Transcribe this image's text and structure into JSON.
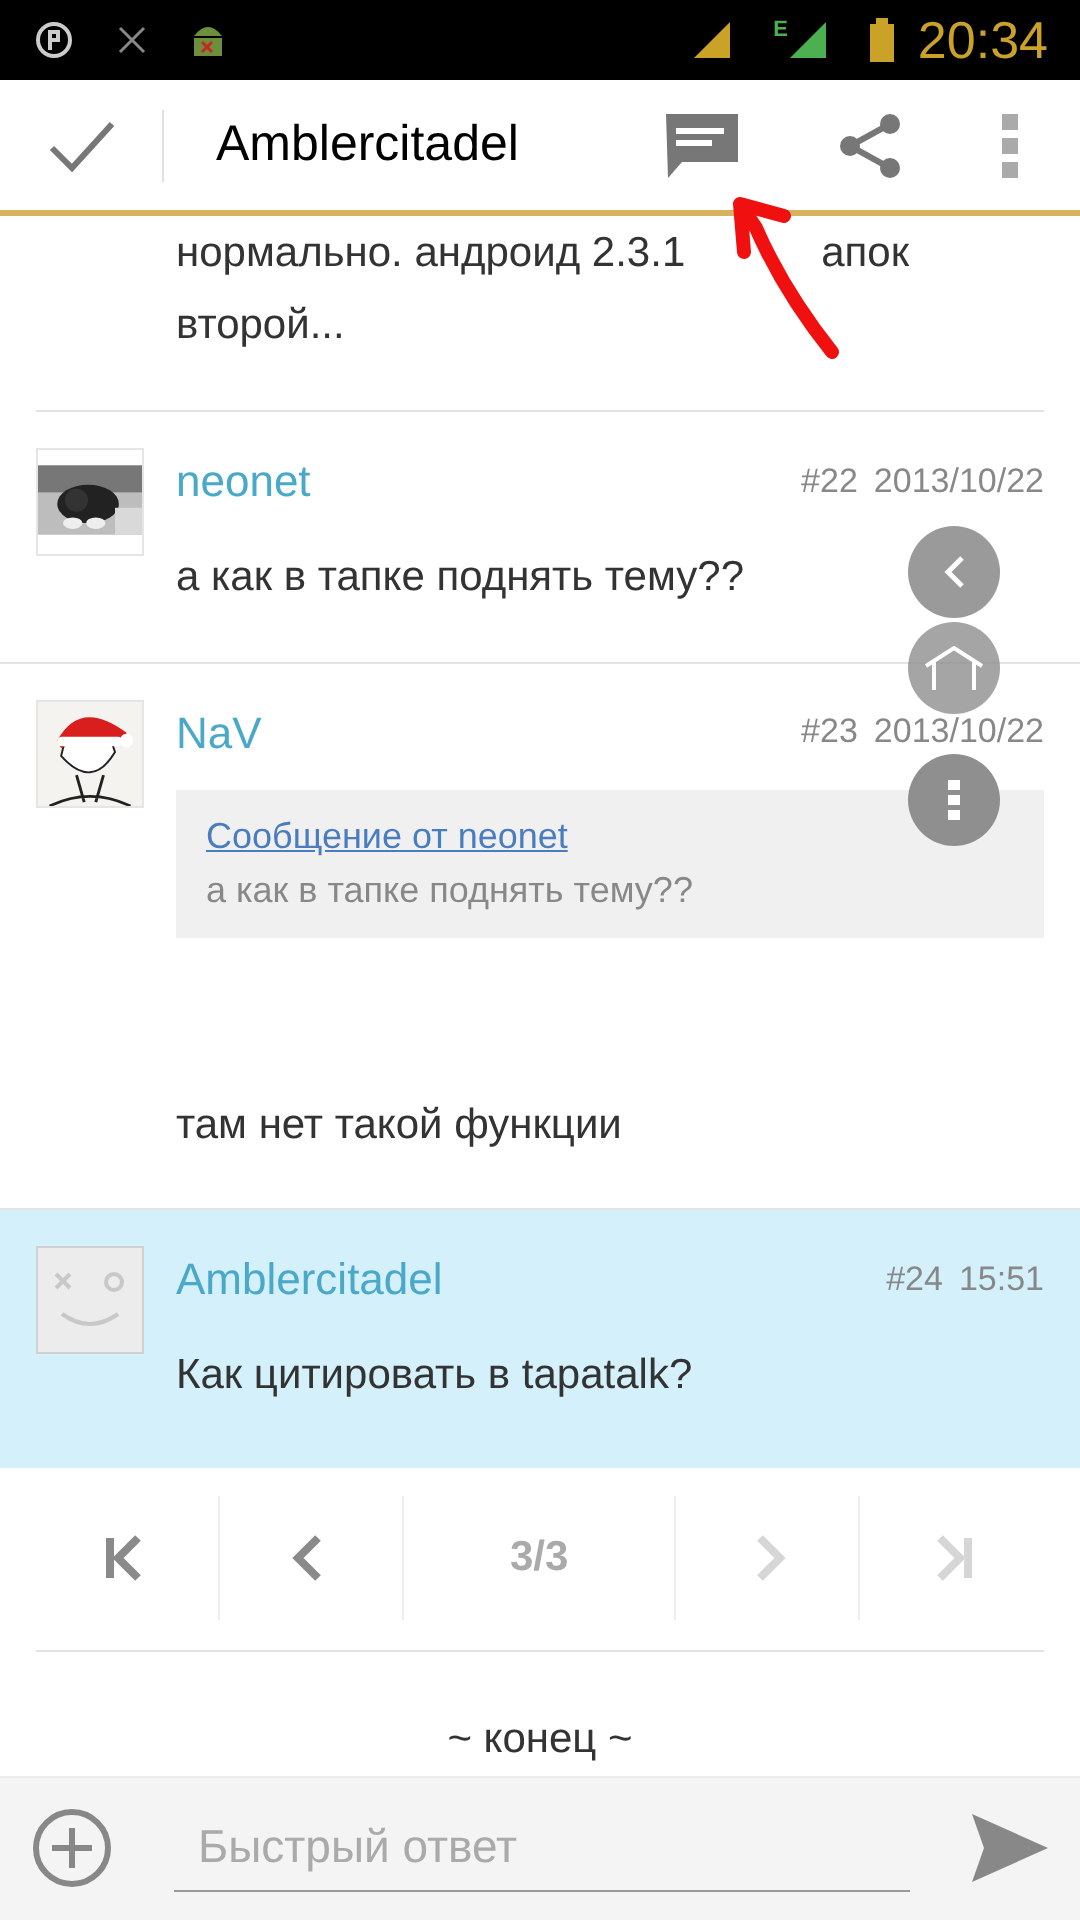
{
  "status_bar": {
    "network": "E",
    "time": "20:34"
  },
  "toolbar": {
    "title": "Amblercitadel"
  },
  "partial_post": {
    "line_start": "нормально. андроид 2.3.1",
    "line_end": "апок",
    "second_line": "второй..."
  },
  "posts": [
    {
      "author": "neonet",
      "number": "#22",
      "date": "2013/10/22",
      "body": "а как в тапке поднять тему??",
      "highlighted": false
    },
    {
      "author": "NaV",
      "number": "#23",
      "date": "2013/10/22",
      "quote": {
        "link": "Сообщение от neonet",
        "text": "а как в тапке поднять тему??"
      },
      "body": "там нет такой функции",
      "highlighted": false
    },
    {
      "author": "Amblercitadel",
      "number": "#24",
      "date": "15:51",
      "avatar": {
        "kind": "placeholder"
      },
      "body": "Как цитировать в tapatalk?",
      "highlighted": true
    }
  ],
  "pager": {
    "page": "3/3",
    "buttons": [
      {
        "kind": "first",
        "disabled": false
      },
      {
        "kind": "prev",
        "disabled": false
      },
      {
        "kind": "next",
        "disabled": true
      },
      {
        "kind": "last",
        "disabled": true
      }
    ]
  },
  "end_label": "~ конец ~",
  "reply": {
    "placeholder": "Быстрый ответ"
  }
}
